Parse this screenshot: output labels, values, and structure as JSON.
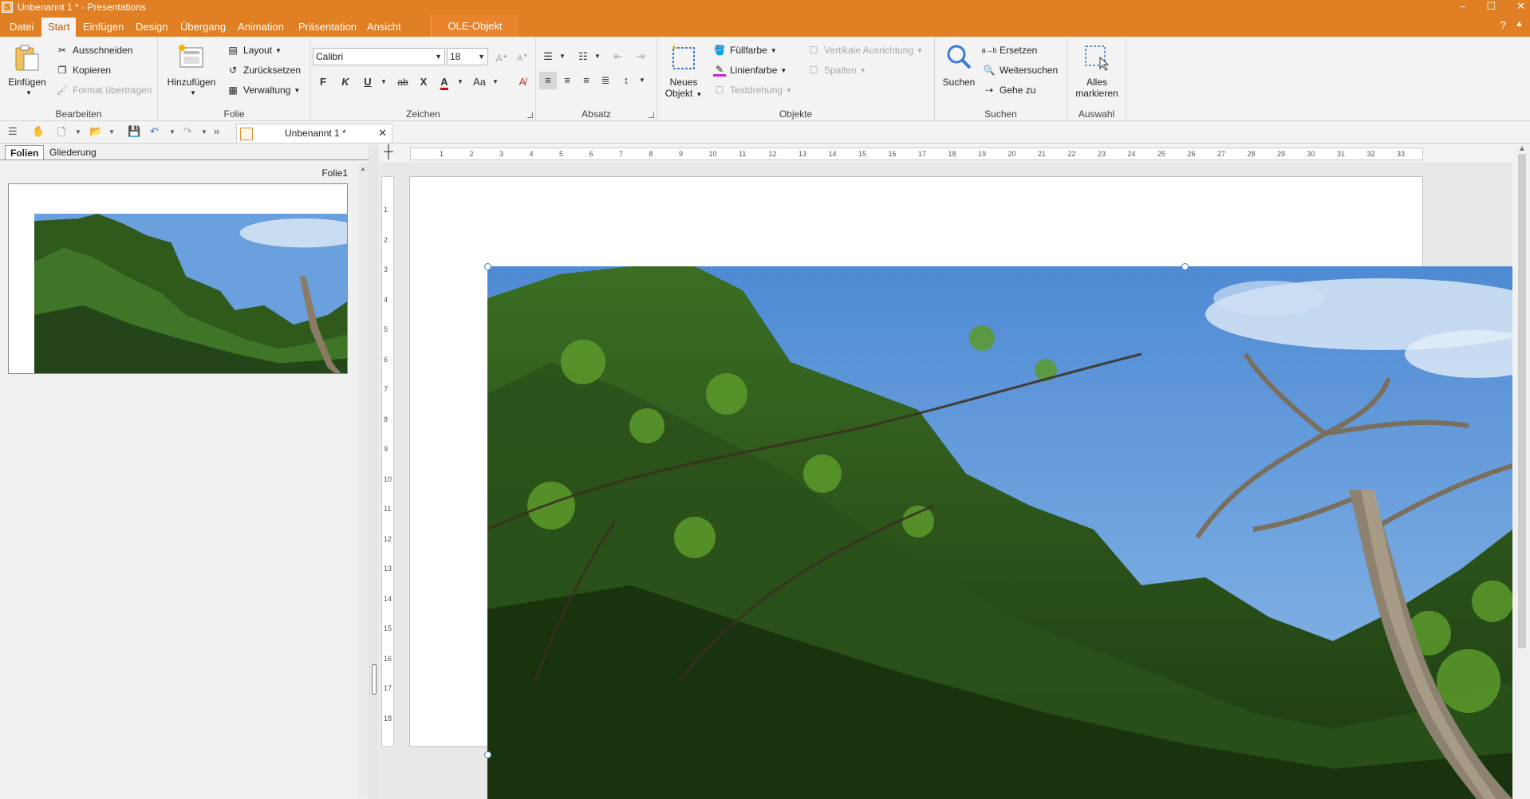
{
  "window": {
    "title": "Unbenannt 1 * - Presentations",
    "app_icon_letter": "S",
    "controls": [
      "–",
      "☐",
      "✕"
    ]
  },
  "menu": {
    "tabs": [
      "Datei",
      "Start",
      "Einfügen",
      "Design",
      "Übergang",
      "Animation",
      "Präsentation",
      "Ansicht"
    ],
    "active_tab": "Start",
    "context_tab": "OLE-Objekt",
    "help": "?"
  },
  "ribbon": {
    "bearbeiten": {
      "label": "Bearbeiten",
      "paste": "Einfügen",
      "cut": "Ausschneiden",
      "copy": "Kopieren",
      "format_painter": "Format übertragen"
    },
    "folie": {
      "label": "Folie",
      "add": "Hinzufügen",
      "layout": "Layout",
      "reset": "Zurücksetzen",
      "manage": "Verwaltung"
    },
    "zeichen": {
      "label": "Zeichen",
      "font": "Calibri",
      "size": "18",
      "bold": "F",
      "italic": "K",
      "underline": "U",
      "strike": "ab",
      "clear": "X"
    },
    "absatz": {
      "label": "Absatz"
    },
    "objekte": {
      "label": "Objekte",
      "new_object_line1": "Neues",
      "new_object_line2": "Objekt",
      "fill": "Füllfarbe",
      "line": "Linienfarbe",
      "text_rotation": "Textdrehung",
      "vertical_align": "Vertikale Ausrichtung",
      "columns": "Spalten"
    },
    "suchen": {
      "label": "Suchen",
      "search": "Suchen",
      "replace": "Ersetzen",
      "find_next": "Weitersuchen",
      "goto": "Gehe zu"
    },
    "auswahl": {
      "label": "Auswahl",
      "select_all_line1": "Alles",
      "select_all_line2": "markieren"
    }
  },
  "document_tab": {
    "label": "Unbenannt 1 *",
    "close": "✕"
  },
  "left_pane": {
    "tabs": [
      "Folien",
      "Gliederung"
    ],
    "active": "Folien",
    "slide_name": "Folie1"
  },
  "ruler": {
    "h_numbers": [
      "1",
      "2",
      "3",
      "4",
      "5",
      "6",
      "7",
      "8",
      "9",
      "10",
      "11",
      "12",
      "13",
      "14",
      "15",
      "16",
      "17",
      "18",
      "19",
      "20",
      "21",
      "22",
      "23",
      "24",
      "25",
      "26",
      "27",
      "28",
      "29",
      "30",
      "31",
      "32",
      "33"
    ],
    "v_numbers": [
      "1",
      "2",
      "3",
      "4",
      "5",
      "6",
      "7",
      "8",
      "9",
      "10",
      "11",
      "12",
      "13",
      "14",
      "15",
      "16",
      "17",
      "18"
    ]
  },
  "colors": {
    "accent": "#e07f24",
    "selection_handle": "#4a7fb8",
    "sky": "#5a92d6",
    "forest": "#2f5a1c"
  },
  "icons": {
    "paste": "clipboard-icon",
    "cut": "scissors-icon",
    "copy": "copy-icon",
    "search": "magnifier-icon"
  }
}
